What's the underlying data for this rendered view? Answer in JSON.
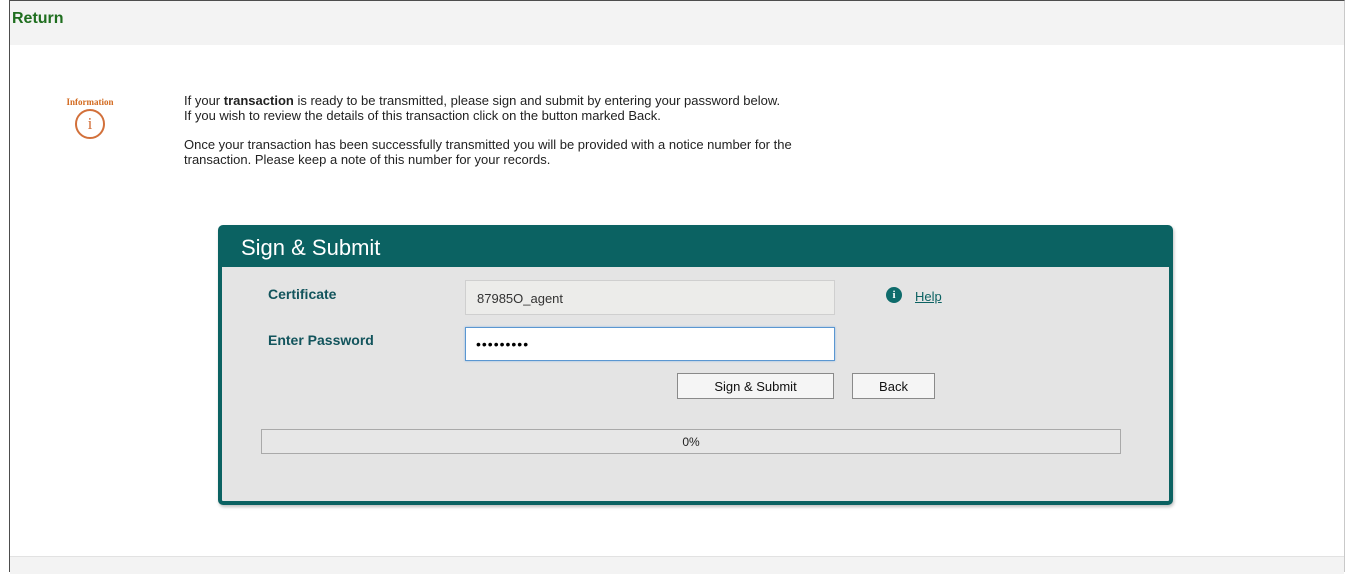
{
  "page": {
    "title": "Return"
  },
  "info": {
    "label": "Information",
    "icon": "info-icon",
    "icon_glyph": "i",
    "line1_before": "If your ",
    "line1_bold": "transaction",
    "line1_after": " is ready to be transmitted, please sign and submit by entering your password below.",
    "line2": "If you wish to review the details of this transaction click on the button marked Back.",
    "line3": "Once your transaction has been successfully transmitted you will be provided with a notice number for the",
    "line4": "transaction. Please keep a note of this number for your records."
  },
  "panel": {
    "title": "Sign & Submit",
    "certificate_label": "Certificate",
    "certificate_value": "87985O_agent",
    "password_label": "Enter Password",
    "password_value": "•••••••••",
    "help_icon_glyph": "i",
    "help_label": "Help",
    "submit_label": "Sign & Submit",
    "back_label": "Back",
    "progress_text": "0%",
    "progress_value": 0
  },
  "colors": {
    "title_green": "#1f6e1f",
    "panel_teal": "#0b6262",
    "info_orange": "#d2703a"
  }
}
